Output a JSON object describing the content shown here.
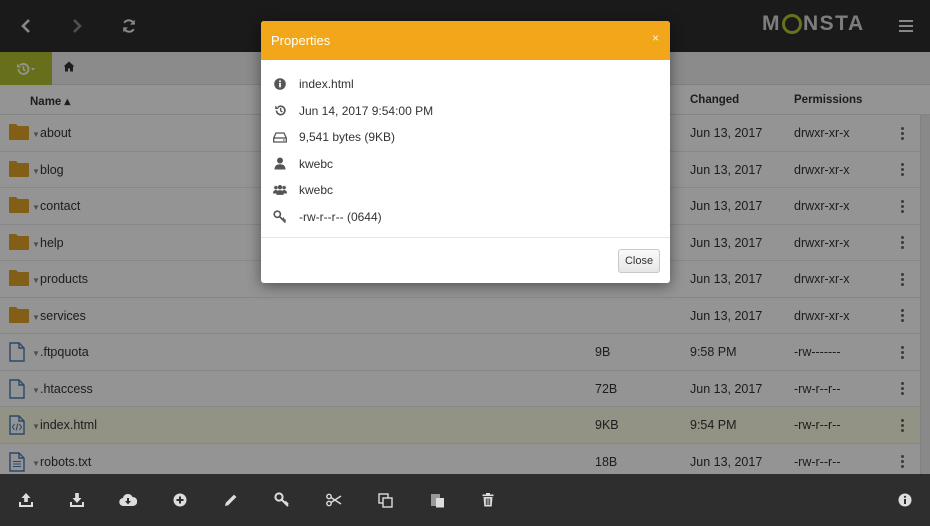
{
  "app": {
    "logo_text_left": "M",
    "logo_text_right": "NSTA"
  },
  "table": {
    "headers": {
      "name": "Name ▴",
      "changed": "Changed",
      "permissions": "Permissions"
    },
    "rows": [
      {
        "type": "folder",
        "name": "about",
        "size": "",
        "changed": "Jun 13, 2017",
        "perm": "drwxr-xr-x"
      },
      {
        "type": "folder",
        "name": "blog",
        "size": "",
        "changed": "Jun 13, 2017",
        "perm": "drwxr-xr-x"
      },
      {
        "type": "folder",
        "name": "contact",
        "size": "",
        "changed": "Jun 13, 2017",
        "perm": "drwxr-xr-x"
      },
      {
        "type": "folder",
        "name": "help",
        "size": "",
        "changed": "Jun 13, 2017",
        "perm": "drwxr-xr-x"
      },
      {
        "type": "folder",
        "name": "products",
        "size": "",
        "changed": "Jun 13, 2017",
        "perm": "drwxr-xr-x"
      },
      {
        "type": "folder",
        "name": "services",
        "size": "",
        "changed": "Jun 13, 2017",
        "perm": "drwxr-xr-x"
      },
      {
        "type": "file",
        "name": ".ftpquota",
        "size": "9B",
        "changed": "9:58 PM",
        "perm": "-rw-------"
      },
      {
        "type": "file",
        "name": ".htaccess",
        "size": "72B",
        "changed": "Jun 13, 2017",
        "perm": "-rw-r--r--"
      },
      {
        "type": "code",
        "name": "index.html",
        "size": "9KB",
        "changed": "9:54 PM",
        "perm": "-rw-r--r--"
      },
      {
        "type": "text",
        "name": "robots.txt",
        "size": "18B",
        "changed": "Jun 13, 2017",
        "perm": "-rw-r--r--"
      }
    ]
  },
  "modal": {
    "title": "Properties",
    "close_x": "×",
    "props": [
      {
        "icon": "info-icon",
        "value": "index.html"
      },
      {
        "icon": "history-icon",
        "value": "Jun 14, 2017 9:54:00 PM"
      },
      {
        "icon": "drive-icon",
        "value": "9,541 bytes (9KB)"
      },
      {
        "icon": "user-icon",
        "value": "kwebc"
      },
      {
        "icon": "group-icon",
        "value": "kwebc"
      },
      {
        "icon": "key-icon",
        "value": "-rw-r--r-- (0644)"
      }
    ],
    "close_label": "Close"
  },
  "colors": {
    "accent": "#f2a619",
    "brand": "#b3bf2e",
    "folder": "#e0a227",
    "file": "#4a7db5",
    "dark": "#2e2e2e"
  }
}
